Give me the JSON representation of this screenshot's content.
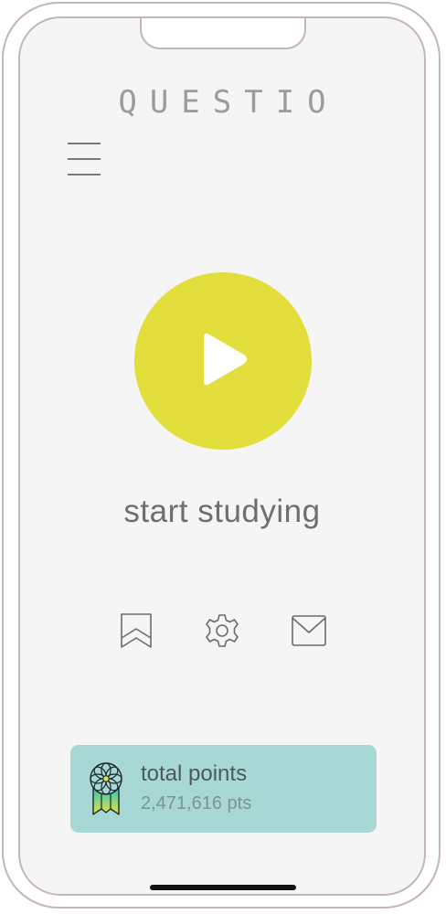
{
  "app": {
    "logo_text": "QUESTIO"
  },
  "main": {
    "start_label": "start studying"
  },
  "stats": {
    "title": "total points",
    "value": "2,471,616 pts"
  },
  "icons": {
    "menu": "hamburger-menu-icon",
    "play": "play-icon",
    "bookmark": "bookmark-icon",
    "settings": "gear-icon",
    "mail": "mail-icon",
    "medal": "medal-icon"
  },
  "colors": {
    "accent": "#e2de3b",
    "card": "#a8d8d6",
    "frame": "#c4b5b8",
    "screen": "#f5f5f5"
  }
}
